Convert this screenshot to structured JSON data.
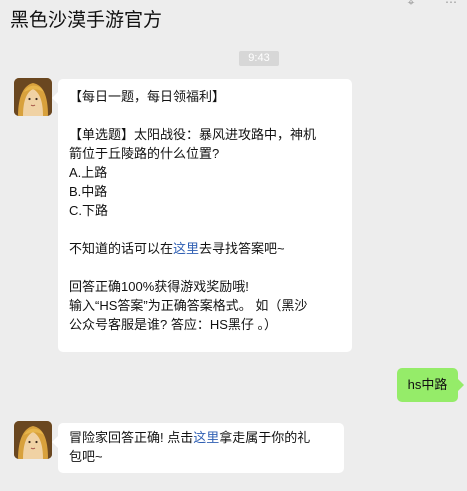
{
  "header": {
    "title": "黑色沙漠手游官方",
    "icons": [
      "pin-icon",
      "more-icon"
    ]
  },
  "time_badge": "9:43",
  "messages": [
    {
      "sender": "official",
      "avatar_icon": "game-character-avatar",
      "lines": [
        "【每日一题，每日领福利】",
        "",
        "【单选题】太阳战役：暴风进攻路中，神机",
        "箭位于丘陵路的什么位置?",
        "A.上路",
        "B.中路",
        "C.下路",
        "",
        "不知道的话可以在",
        "这里",
        "去寻找答案吧~",
        "",
        "回答正确100%获得游戏奖励哦!",
        "输入“HS答案”为正确答案格式。 如（黑沙",
        "公众号客服是谁? 答应：HS黑仔 。）"
      ]
    },
    {
      "sender": "user",
      "text": "hs中路"
    },
    {
      "sender": "official",
      "avatar_icon": "game-character-avatar",
      "lines": [
        "冒险家回答正确! 点击",
        "这里",
        "拿走属于你的礼",
        "包吧~"
      ]
    }
  ],
  "colors": {
    "background": "#ededed",
    "incoming_bubble": "#ffffff",
    "outgoing_bubble": "#95ec69",
    "link": "#2f5fb3",
    "time_badge": "#d7d7d7"
  }
}
